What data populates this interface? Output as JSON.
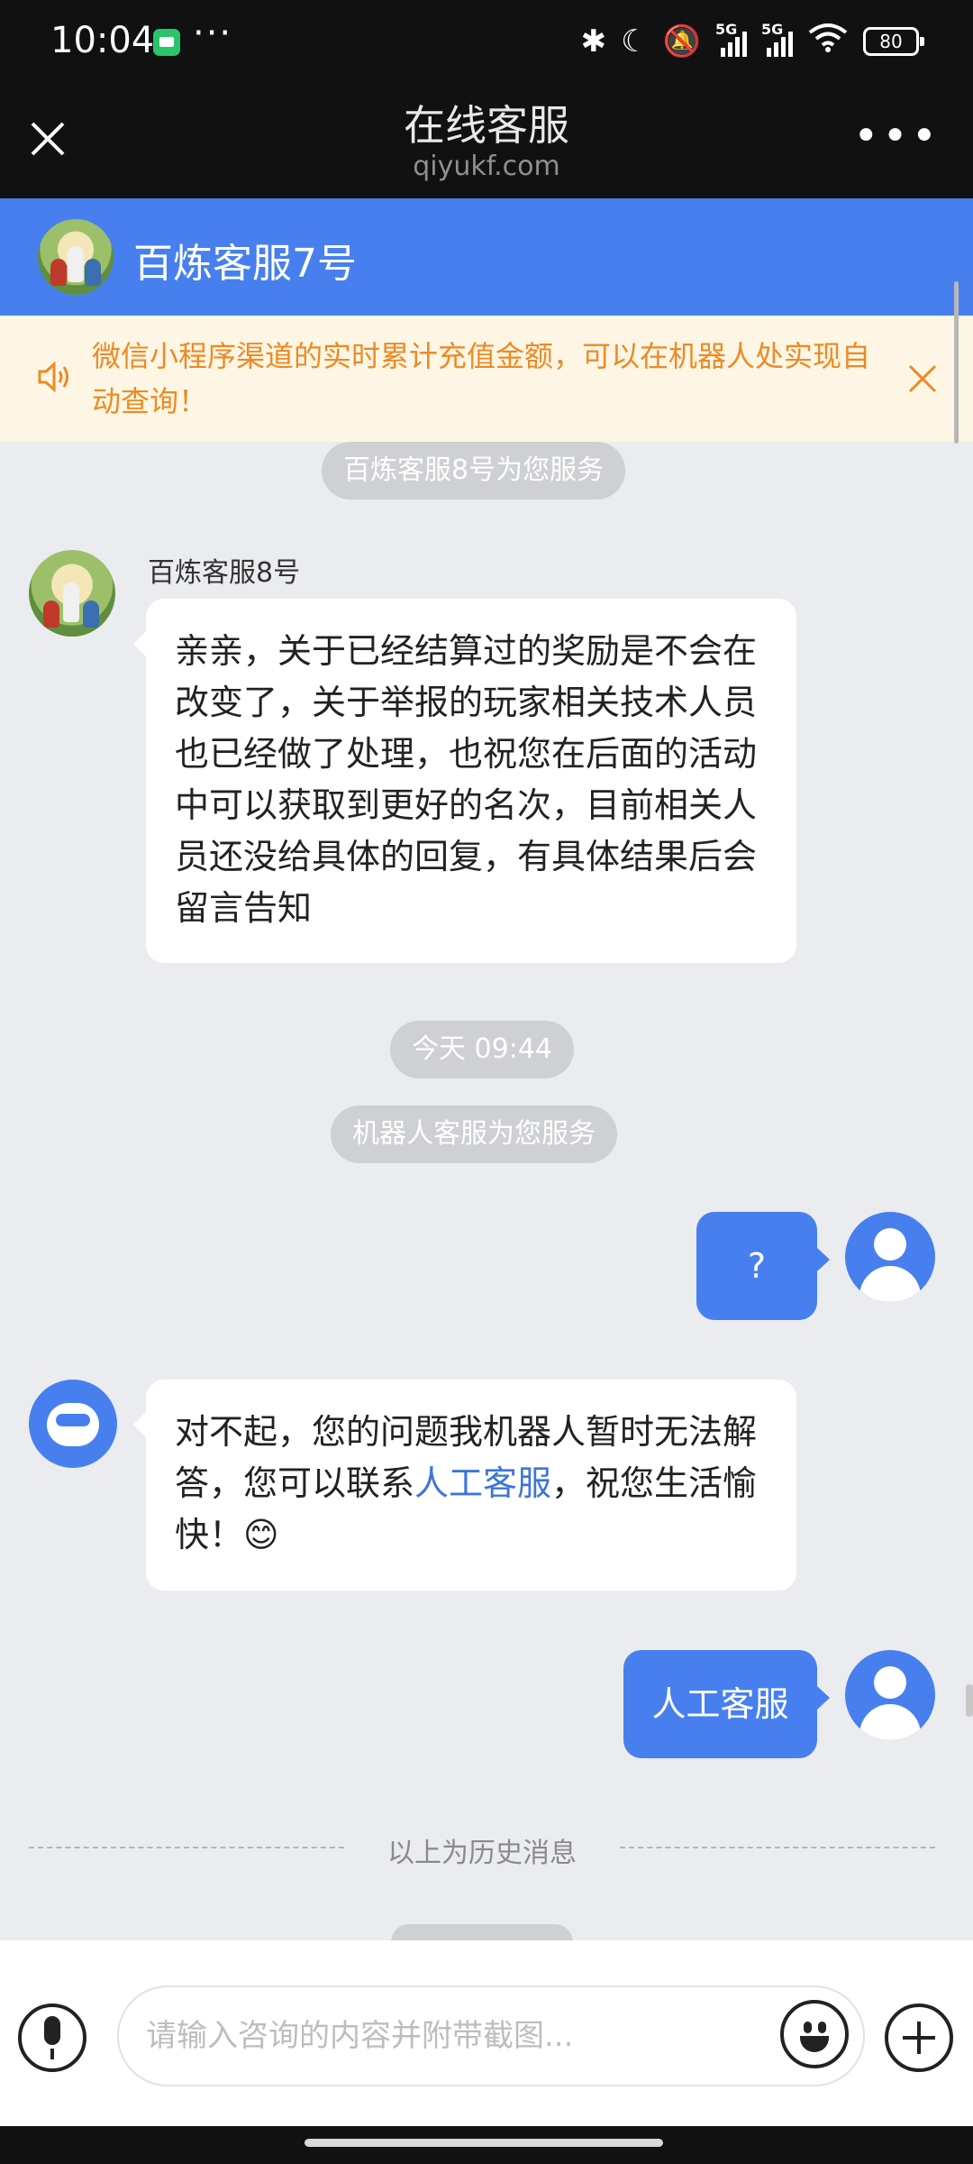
{
  "status_bar": {
    "time": "10:04",
    "dots": "···",
    "network1": "5G",
    "network2": "5G",
    "battery": "80"
  },
  "title_bar": {
    "title": "在线客服",
    "subtitle": "qiyukf.com"
  },
  "agent_header": {
    "name": "百炼客服7号"
  },
  "notice": {
    "text": "微信小程序渠道的实时累计充值金额，可以在机器人处实现自动查询！"
  },
  "messages": {
    "service_pill_1": "百炼客服8号为您服务",
    "agent_sender": "百炼客服8号",
    "agent_msg": "亲亲，关于已经结算过的奖励是不会在改变了，关于举报的玩家相关技术人员也已经做了处理，也祝您在后面的活动中可以获取到更好的名次，目前相关人员还没给具体的回复，有具体结果后会留言告知",
    "time_pill": "今天 09:44",
    "service_pill_2": "机器人客服为您服务",
    "user_msg_1": "?",
    "bot_msg_prefix": "对不起，您的问题我机器人暂时无法解答，您可以联系",
    "bot_msg_link": "人工客服",
    "bot_msg_suffix": "，祝您生活愉快！😊",
    "user_msg_2": "人工客服",
    "history_divider": "以上为历史消息"
  },
  "input_bar": {
    "placeholder": "请输入咨询的内容并附带截图..."
  },
  "colors": {
    "accent": "#4780ee",
    "notice_text": "#ed8a25",
    "notice_bg": "#fdf6e4",
    "chat_bg": "#ebecef"
  }
}
